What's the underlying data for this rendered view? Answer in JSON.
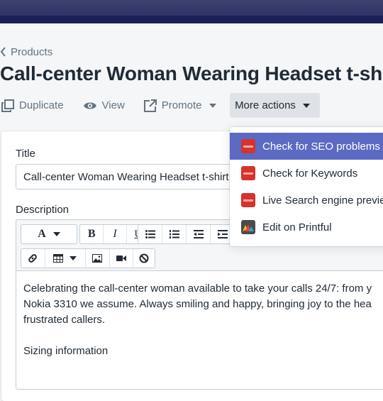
{
  "breadcrumb": {
    "label": "Products"
  },
  "page": {
    "title": "Call-center Woman Wearing Headset t-shirt"
  },
  "actions": {
    "duplicate": "Duplicate",
    "view": "View",
    "promote": "Promote",
    "more": "More actions"
  },
  "dropdown": {
    "items": [
      {
        "label": "Check for SEO problems",
        "icon": "seo-icon",
        "active": true
      },
      {
        "label": "Check for Keywords",
        "icon": "seo-icon"
      },
      {
        "label": "Live Search engine preview",
        "icon": "seo-icon"
      },
      {
        "label": "Edit on Printful",
        "icon": "printful-icon"
      }
    ]
  },
  "form": {
    "title_label": "Title",
    "title_value": "Call-center Woman Wearing Headset t-shirt",
    "description_label": "Description"
  },
  "editor": {
    "toolbar": {
      "font": "A",
      "bold": "B",
      "italic": "I",
      "underline": "U"
    },
    "lines": [
      "Celebrating the call-center woman available to take your calls 24/7: from y",
      "Nokia 3310 we assume. Always smiling and happy, bringing joy to the hea",
      "frustrated callers.",
      "",
      "Sizing information"
    ]
  },
  "colors": {
    "topbar": "#2f3266",
    "accent": "#5c6ac4",
    "seo_icon": "#d8322c"
  }
}
